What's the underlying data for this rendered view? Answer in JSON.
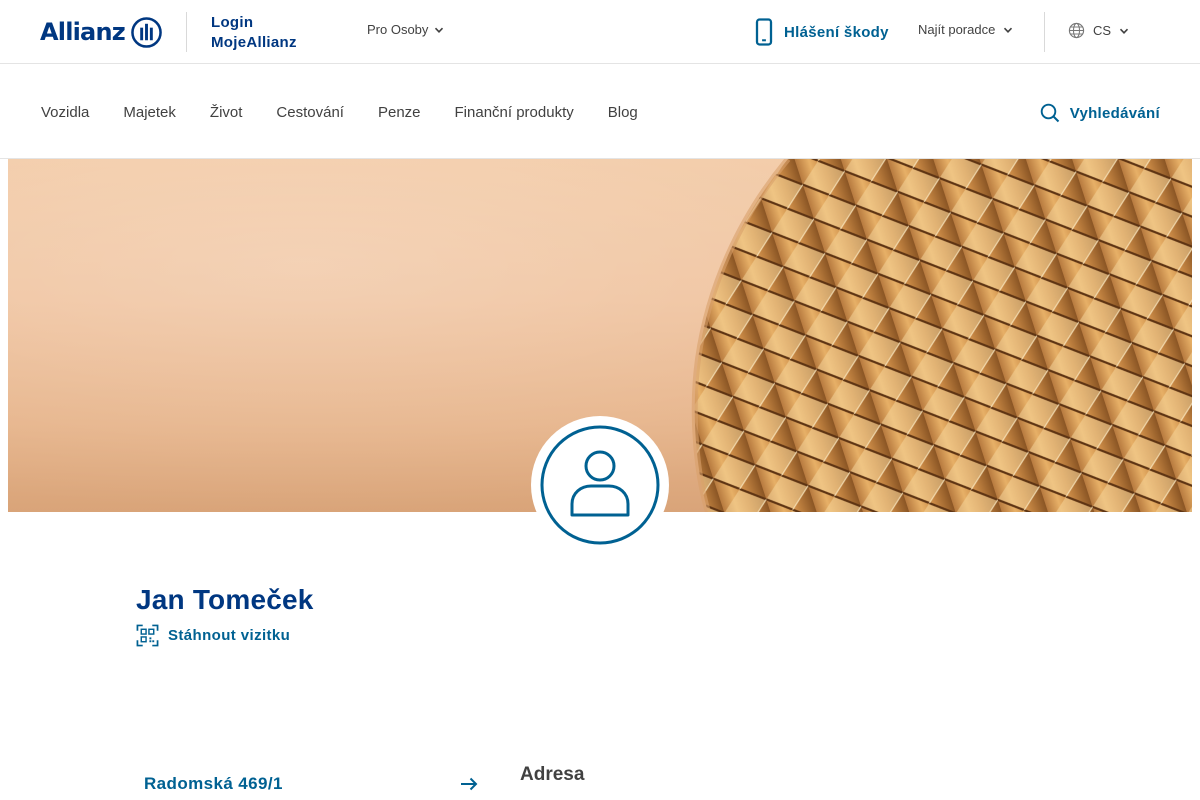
{
  "header": {
    "logo_text": "Allianz",
    "login_line1": "Login",
    "login_line2": "MojeAllianz",
    "segment_label": "Pro Osoby",
    "claim_label": "Hlášení škody",
    "find_advisor_label": "Najít poradce",
    "language_label": "CS"
  },
  "nav": {
    "items": [
      "Vozidla",
      "Majetek",
      "Život",
      "Cestování",
      "Penze",
      "Finanční produkty",
      "Blog"
    ],
    "search_label": "Vyhledávání"
  },
  "profile": {
    "name": "Jan Tomeček",
    "vcard_label": "Stáhnout vizitku"
  },
  "address": {
    "link_text": "Radomská 469/1",
    "heading": "Adresa"
  },
  "colors": {
    "brand": "#003781",
    "link": "#006192",
    "text": "#414141"
  }
}
